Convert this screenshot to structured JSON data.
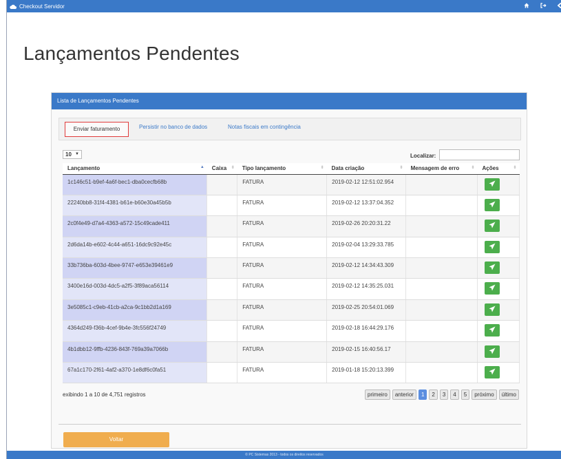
{
  "app": {
    "title": "Checkout Servidor",
    "icons": [
      "home-icon",
      "sign-out-icon",
      "arrow-left-icon"
    ],
    "accent": "#3a79c8"
  },
  "page": {
    "title": "Lançamentos Pendentes"
  },
  "panel": {
    "title": "Lista de Lançamentos Pendentes"
  },
  "tabs": [
    {
      "label": "Enviar faturamento",
      "active": true
    },
    {
      "label": "Persistir no banco de dados",
      "active": false
    },
    {
      "label": "Notas fiscais em contingência",
      "active": false
    }
  ],
  "controls": {
    "page_length": "10",
    "search_label": "Localizar:",
    "search_value": ""
  },
  "table": {
    "columns": [
      "Lançamento",
      "Caixa",
      "Tipo lançamento",
      "Data criação",
      "Mensagem de erro",
      "Ações"
    ],
    "rows": [
      {
        "id": "1c146c51-b9ef-4a6f-bec1-dba0cecfb68b",
        "caixa": "",
        "tipo": "FATURA",
        "data": "2019-02-12 12:51:02.954",
        "erro": ""
      },
      {
        "id": "22240bb8-31f4-4381-b61e-b60e30a45b5b",
        "caixa": "",
        "tipo": "FATURA",
        "data": "2019-02-12 13:37:04.352",
        "erro": ""
      },
      {
        "id": "2c0f4e49-d7a4-4363-a572-15c49cade411",
        "caixa": "",
        "tipo": "FATURA",
        "data": "2019-02-26 20:20:31.22",
        "erro": ""
      },
      {
        "id": "2d6da14b-e602-4c44-a651-16dc9c92e45c",
        "caixa": "",
        "tipo": "FATURA",
        "data": "2019-02-04 13:29:33.785",
        "erro": ""
      },
      {
        "id": "33b736ba-603d-4bee-9747-e653e39461e9",
        "caixa": "",
        "tipo": "FATURA",
        "data": "2019-02-12 14:34:43.309",
        "erro": ""
      },
      {
        "id": "3400e16d-003d-4dc5-a2f5-3f89aca56114",
        "caixa": "",
        "tipo": "FATURA",
        "data": "2019-02-12 14:35:25.031",
        "erro": ""
      },
      {
        "id": "3e5085c1-c9eb-41cb-a2ca-9c1bb2d1a169",
        "caixa": "",
        "tipo": "FATURA",
        "data": "2019-02-25 20:54:01.069",
        "erro": ""
      },
      {
        "id": "4364d249-f36b-4cef-9b4e-3fc556f24749",
        "caixa": "",
        "tipo": "FATURA",
        "data": "2019-02-18 16:44:29.176",
        "erro": ""
      },
      {
        "id": "4b1dbb12-9ffb-4236-843f-769a39a7066b",
        "caixa": "",
        "tipo": "FATURA",
        "data": "2019-02-15 16:40:56.17",
        "erro": ""
      },
      {
        "id": "67a1c170-2f61-4af2-a370-1e8df6c0fa51",
        "caixa": "",
        "tipo": "FATURA",
        "data": "2019-01-18 15:20:13.399",
        "erro": ""
      }
    ]
  },
  "footer_info": {
    "text": "exibindo 1 a 10 de 4,751 registros"
  },
  "pagination": {
    "first": "primeiro",
    "prev": "anterior",
    "pages": [
      "1",
      "2",
      "3",
      "4",
      "5"
    ],
    "current": "1",
    "next": "próximo",
    "last": "último"
  },
  "back_button": {
    "label": "Voltar",
    "color": "#f0ad4e"
  },
  "footer": {
    "text": "© PC Sistemas 2013 - todos os direitos reservados"
  },
  "action_button": {
    "icon": "paper-plane-icon",
    "color": "#4cae4c"
  }
}
